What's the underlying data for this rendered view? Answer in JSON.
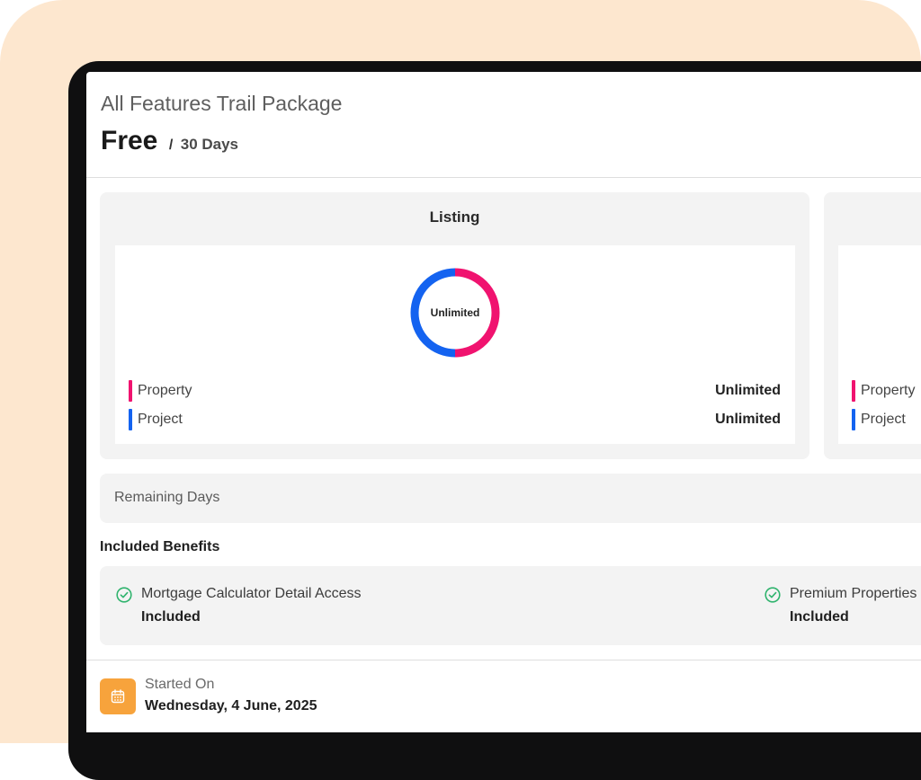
{
  "package": {
    "name": "All Features Trail Package",
    "price": "Free",
    "separator": "/",
    "duration": "30 Days"
  },
  "listing": {
    "title": "Listing",
    "center_label": "Unlimited",
    "items": [
      {
        "label": "Property",
        "value": "Unlimited",
        "color": "#f0136f"
      },
      {
        "label": "Project",
        "value": "Unlimited",
        "color": "#1463f0"
      }
    ]
  },
  "second_card": {
    "items": [
      {
        "label": "Property",
        "color": "#f0136f"
      },
      {
        "label": "Project",
        "color": "#1463f0"
      }
    ]
  },
  "remaining": {
    "label": "Remaining Days"
  },
  "benefits": {
    "title": "Included Benefits",
    "items": [
      {
        "name": "Mortgage Calculator Detail Access",
        "status": "Included"
      },
      {
        "name": "Premium Properties",
        "status": "Included"
      }
    ]
  },
  "started": {
    "label": "Started On",
    "date": "Wednesday, 4 June, 2025"
  },
  "colors": {
    "accent_pink": "#f0136f",
    "accent_blue": "#1463f0",
    "check_green": "#2fb36d",
    "calendar_orange": "#f7a33c"
  }
}
